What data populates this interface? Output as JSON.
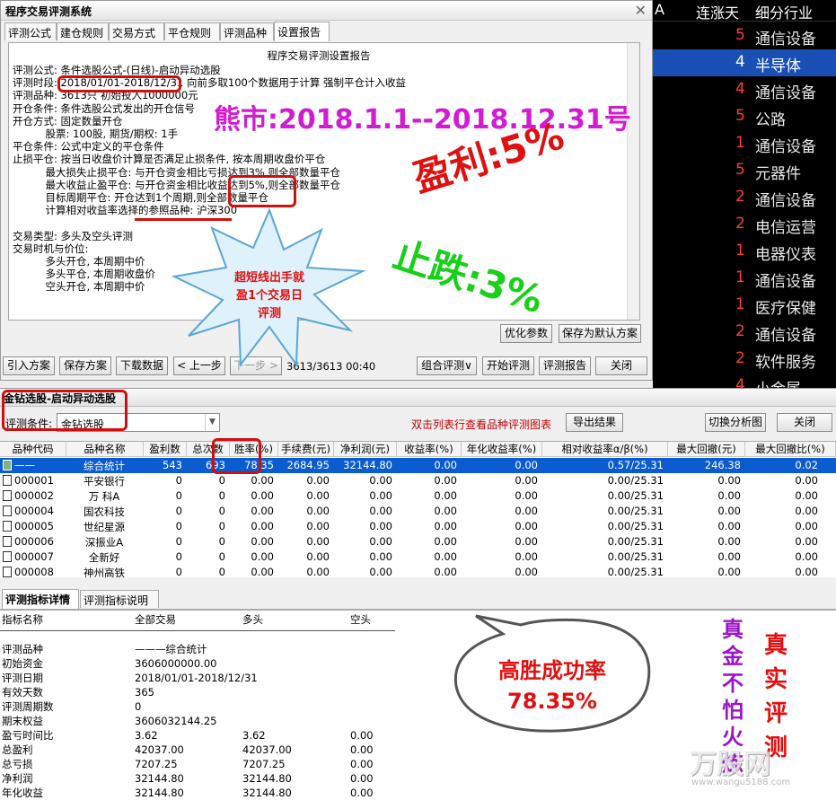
{
  "market_panel": {
    "header": [
      "A",
      "连涨天",
      "细分行业"
    ],
    "rows": [
      {
        "n": "5",
        "t": "通信设备"
      },
      {
        "n": "4",
        "t": "半导体"
      },
      {
        "n": "4",
        "t": "通信设备"
      },
      {
        "n": "5",
        "t": "公路"
      },
      {
        "n": "1",
        "t": "通信设备"
      },
      {
        "n": "5",
        "t": "元器件"
      },
      {
        "n": "2",
        "t": "通信设备"
      },
      {
        "n": "2",
        "t": "电信运营"
      },
      {
        "n": "1",
        "t": "电器仪表"
      },
      {
        "n": "1",
        "t": "通信设备"
      },
      {
        "n": "1",
        "t": "医疗保健"
      },
      {
        "n": "2",
        "t": "通信设备"
      },
      {
        "n": "2",
        "t": "软件服务"
      },
      {
        "n": "4",
        "t": "小金属"
      }
    ]
  },
  "dialog": {
    "title": "程序交易评测系统",
    "close": "✕",
    "tabs": [
      "评测公式",
      "建仓规则",
      "交易方式",
      "平仓规则",
      "评测品种",
      "设置报告"
    ],
    "report_heading": "程序交易评测设置报告",
    "report_lines": [
      "评测公式: 条件选股公式-(日线)-启动异动选股",
      "评测时段: 2018/01/01-2018/12/31 向前多取100个数据用于计算 强制平仓计入收益",
      "评测品种: 3613只 初始投入1000000元",
      "开仓条件: 条件选股公式发出的开仓信号",
      "开仓方式: 固定数量开仓",
      "          股票: 100股, 期货/期权: 1手",
      "平仓条件: 公式中定义的平仓条件",
      "止损平仓: 按当日收盘价计算是否满足止损条件, 按本周期收盘价平仓",
      "          最大损失止损平仓: 与开仓资金相比亏损达到3%,则全部数量平仓",
      "          最大收益止盈平仓: 与开仓资金相比收益达到5%,则全部数量平仓",
      "          目标周期平仓: 开仓达到1个周期,则全部数量平仓",
      "          计算相对收益率选择的参照品种: 沪深300",
      "",
      "交易类型: 多头及空头评测",
      "交易时机与价位:",
      "          多头开仓, 本周期中价",
      "          多头平仓, 本周期收盘价",
      "          空头开仓, 本周期中价"
    ],
    "btn_optimize": "优化参数",
    "btn_save_default": "保存为默认方案",
    "btn_import": "引入方案",
    "btn_save": "保存方案",
    "btn_download": "下载数据",
    "btn_prev": "< 上一步",
    "btn_next": "下一步 >",
    "progress_text": "3613/3613 00:40",
    "btn_combo": "组合评测∨",
    "btn_start": "开始评测",
    "btn_report": "评测报告",
    "btn_close": "关闭"
  },
  "bottom": {
    "title": "金钻选股-启动异动选股",
    "cond_label": "评测条件:",
    "cond_value": "金钻选股",
    "hint": "双击列表行查看品种评测图表",
    "btn_export": "导出结果",
    "btn_switch": "切换分析图",
    "btn_close": "关闭",
    "columns": [
      "品种代码",
      "品种名称",
      "盈利数",
      "总次数",
      "胜率(%)",
      "手续费(元)",
      "净利润(元)",
      "收益率(%)",
      "年化收益率(%)",
      "相对收益率α/β(%)",
      "最大回撤(元)",
      "最大回撤比(%)"
    ],
    "rows": [
      [
        "——",
        "综合统计",
        "543",
        "693",
        "78.35",
        "2684.95",
        "32144.80",
        "0.00",
        "0.00",
        "0.57/25.31",
        "246.38",
        "0.02"
      ],
      [
        "000001",
        "平安银行",
        "0",
        "0",
        "0.00",
        "0.00",
        "0.00",
        "0.00",
        "0.00",
        "0.00/25.31",
        "0.00",
        "0.00"
      ],
      [
        "000002",
        "万 科A",
        "0",
        "0",
        "0.00",
        "0.00",
        "0.00",
        "0.00",
        "0.00",
        "0.00/25.31",
        "0.00",
        "0.00"
      ],
      [
        "000004",
        "国农科技",
        "0",
        "0",
        "0.00",
        "0.00",
        "0.00",
        "0.00",
        "0.00",
        "0.00/25.31",
        "0.00",
        "0.00"
      ],
      [
        "000005",
        "世纪星源",
        "0",
        "0",
        "0.00",
        "0.00",
        "0.00",
        "0.00",
        "0.00",
        "0.00/25.31",
        "0.00",
        "0.00"
      ],
      [
        "000006",
        "深振业A",
        "0",
        "0",
        "0.00",
        "0.00",
        "0.00",
        "0.00",
        "0.00",
        "0.00/25.31",
        "0.00",
        "0.00"
      ],
      [
        "000007",
        "全新好",
        "0",
        "0",
        "0.00",
        "0.00",
        "0.00",
        "0.00",
        "0.00",
        "0.00/25.31",
        "0.00",
        "0.00"
      ],
      [
        "000008",
        "神州高铁",
        "0",
        "0",
        "0.00",
        "0.00",
        "0.00",
        "0.00",
        "0.00",
        "0.00/25.31",
        "0.00",
        "0.00"
      ]
    ],
    "detail_tabs": [
      "评测指标详情",
      "评测指标说明"
    ],
    "stats_header": [
      "指标名称",
      "全部交易",
      "多头",
      "空头"
    ],
    "stats_rows": [
      [
        "评测品种",
        "———综合统计",
        "",
        ""
      ],
      [
        "初始资金",
        "3606000000.00",
        "",
        ""
      ],
      [
        "评测日期",
        "2018/01/01-2018/12/31",
        "",
        ""
      ],
      [
        "有效天数",
        "365",
        "",
        ""
      ],
      [
        "评测周期数",
        "0",
        "",
        ""
      ],
      [
        "期末权益",
        "3606032144.25",
        "",
        ""
      ],
      [
        "盈亏时间比",
        "3.62",
        "3.62",
        "0.00"
      ],
      [
        "总盈利",
        "42037.00",
        "42037.00",
        "0.00"
      ],
      [
        "总亏损",
        "7207.25",
        "7207.25",
        "0.00"
      ],
      [
        "净利润",
        "32144.80",
        "32144.80",
        "0.00"
      ],
      [
        "年化收益",
        "32144.80",
        "32144.80",
        "0.00"
      ]
    ]
  },
  "overlays": {
    "bear_market": "熊市:2018.1.1--2018.12.31号",
    "profit": "盈利:5%",
    "stop_loss": "止跌:3%",
    "burst_text": [
      "超短线出手就",
      "盈1个交易日",
      "评测"
    ],
    "bubble_text": [
      "高胜成功率",
      "78.35%"
    ],
    "vert_purple": [
      "真",
      "金",
      "不",
      "怕",
      "火",
      "炼"
    ],
    "vert_red": [
      "真",
      "实",
      "评",
      "测"
    ],
    "watermark": "万股网",
    "watermark_sub": "www.wangu5188.com"
  },
  "colors": {
    "accent_red": "#e01010",
    "magenta": "#d21bd2",
    "green": "#19d019",
    "purple": "#9a16c9",
    "select_blue": "#0a5cd0"
  }
}
